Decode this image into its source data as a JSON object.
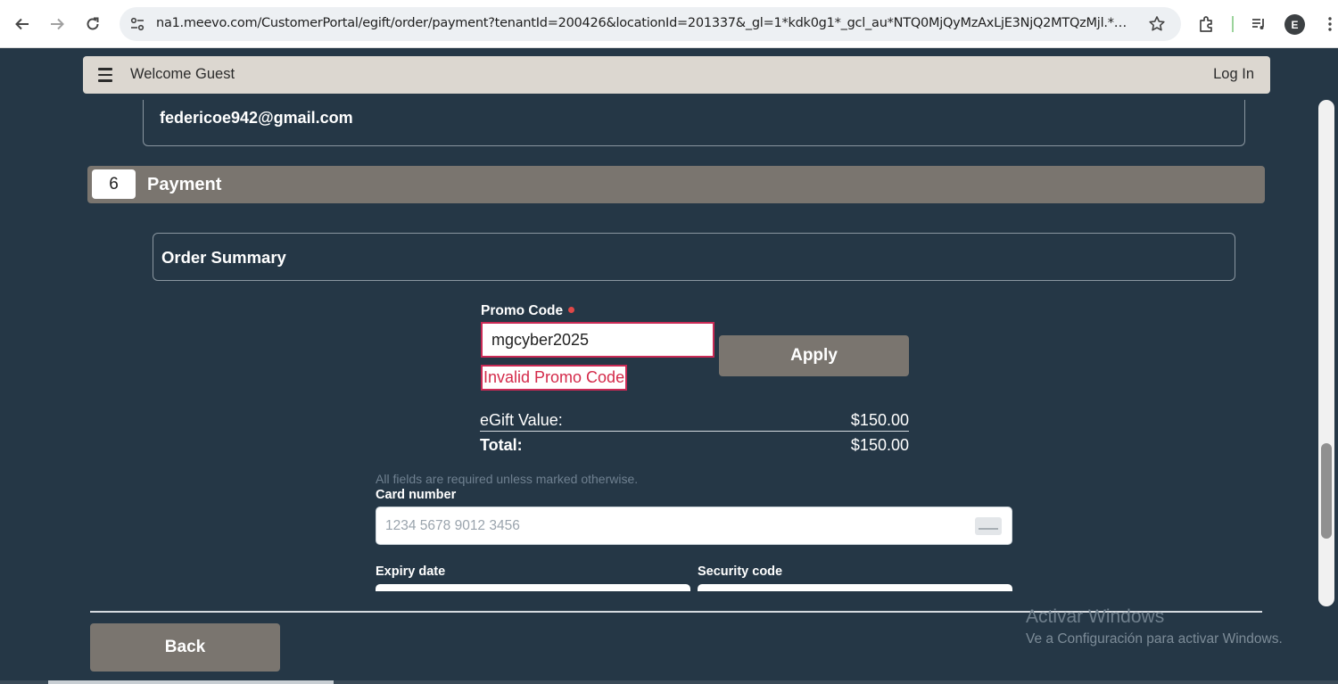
{
  "browser": {
    "url": "na1.meevo.com/CustomerPortal/egift/order/payment?tenantId=200426&locationId=201337&_gl=1*kdk0g1*_gcl_au*NTQ0MjQyMzAxLjE3NjQ2MTQzMjl.*_ga*...",
    "profile_initial": "E",
    "icons": [
      "back-arrow-icon",
      "forward-arrow-icon",
      "reload-icon",
      "site-info-icon",
      "star-icon",
      "extensions-icon",
      "media-control-icon",
      "kebab-menu-icon"
    ]
  },
  "header": {
    "welcome": "Welcome Guest",
    "login": "Log In"
  },
  "recipient": {
    "email": "federicoe942@gmail.com"
  },
  "section": {
    "step": "6",
    "title": "Payment"
  },
  "order_summary": {
    "title": "Order Summary"
  },
  "promo": {
    "label": "Promo Code",
    "value": "mgcyber2025",
    "apply": "Apply",
    "error": "Invalid Promo Code"
  },
  "totals": {
    "egift_label": "eGift Value:",
    "egift_value": "$150.00",
    "total_label": "Total:",
    "total_value": "$150.00"
  },
  "card": {
    "note": "All fields are required unless marked otherwise.",
    "number_label": "Card number",
    "number_placeholder": "1234 5678 9012 3456",
    "expiry_label": "Expiry date",
    "security_label": "Security code"
  },
  "footer": {
    "back": "Back"
  },
  "watermark": {
    "line1": "Activar Windows",
    "line2": "Ve a Configuración para activar Windows."
  },
  "colors": {
    "page_bg": "#253746",
    "header_bg": "#dcd7d0",
    "accent_gray": "#7a756f",
    "error": "#c92a55"
  }
}
